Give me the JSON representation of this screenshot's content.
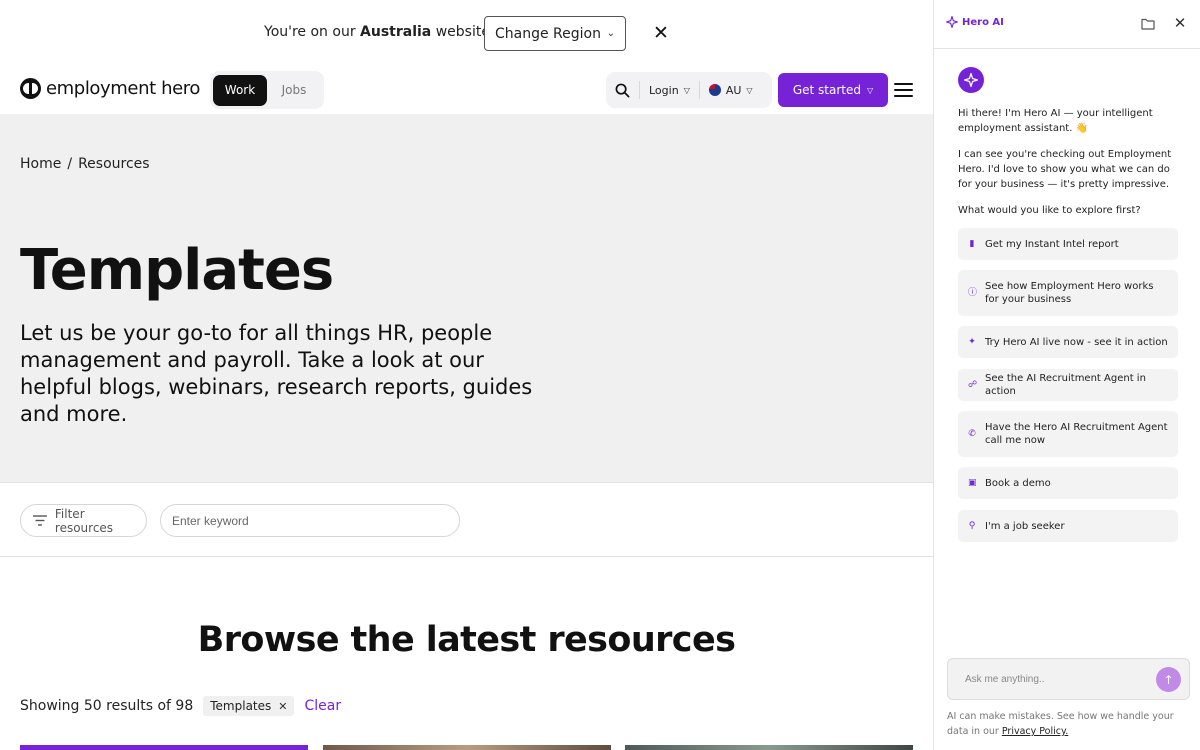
{
  "region_banner": {
    "prefix": "You're on our ",
    "country": "Australia",
    "suffix": " website",
    "select_label": "Change Region",
    "close_symbol": "✕"
  },
  "nav": {
    "logo_text": "employment hero",
    "toggle": {
      "work": "Work",
      "jobs": "Jobs",
      "active": "Work"
    },
    "login": "Login",
    "region": "AU",
    "cta": "Get started"
  },
  "hero": {
    "breadcrumb": {
      "home": "Home",
      "separator": "/",
      "current": "Resources"
    },
    "title": "Templates",
    "description": "Let us be your go-to for all things HR, people management and payroll. Take a look at our helpful blogs, webinars, research reports, guides and more."
  },
  "filters": {
    "filter_button": "Filter resources",
    "keyword_placeholder": "Enter keyword",
    "keyword_value": ""
  },
  "browse": {
    "title": "Browse the latest resources",
    "results_text": "Showing 50 results of 98",
    "active_filter": "Templates",
    "clear_label": "Clear"
  },
  "assistant": {
    "brand": "Hero AI",
    "greeting": "Hi there! I'm Hero AI — your intelligent employment assistant. 👋",
    "intro": "I can see you're checking out Employment Hero. I'd love to show you what we can do for your business — it's pretty impressive.",
    "question": "What would you like to explore first?",
    "options": [
      {
        "label": "Get my Instant Intel report",
        "icon": "bar-chart-icon"
      },
      {
        "label": "See how Employment Hero works for your business",
        "icon": "info-circle-icon"
      },
      {
        "label": "Try Hero AI live now - see it in action",
        "icon": "sparkle-icon"
      },
      {
        "label": "See the AI Recruitment Agent in action",
        "icon": "user-plus-icon"
      },
      {
        "label": "Have the Hero AI Recruitment Agent call me now",
        "icon": "phone-icon"
      },
      {
        "label": "Book a demo",
        "icon": "calendar-icon"
      },
      {
        "label": "I'm a job seeker",
        "icon": "person-icon"
      }
    ],
    "input_placeholder": "Ask me anything..",
    "disclaimer": "AI can make mistakes. See how we handle your data in our ",
    "privacy_link": "Privacy Policy."
  },
  "colors": {
    "brand_purple": "#7622d7",
    "send_button": "#c28ae8",
    "hero_background": "#f0f0f0"
  }
}
